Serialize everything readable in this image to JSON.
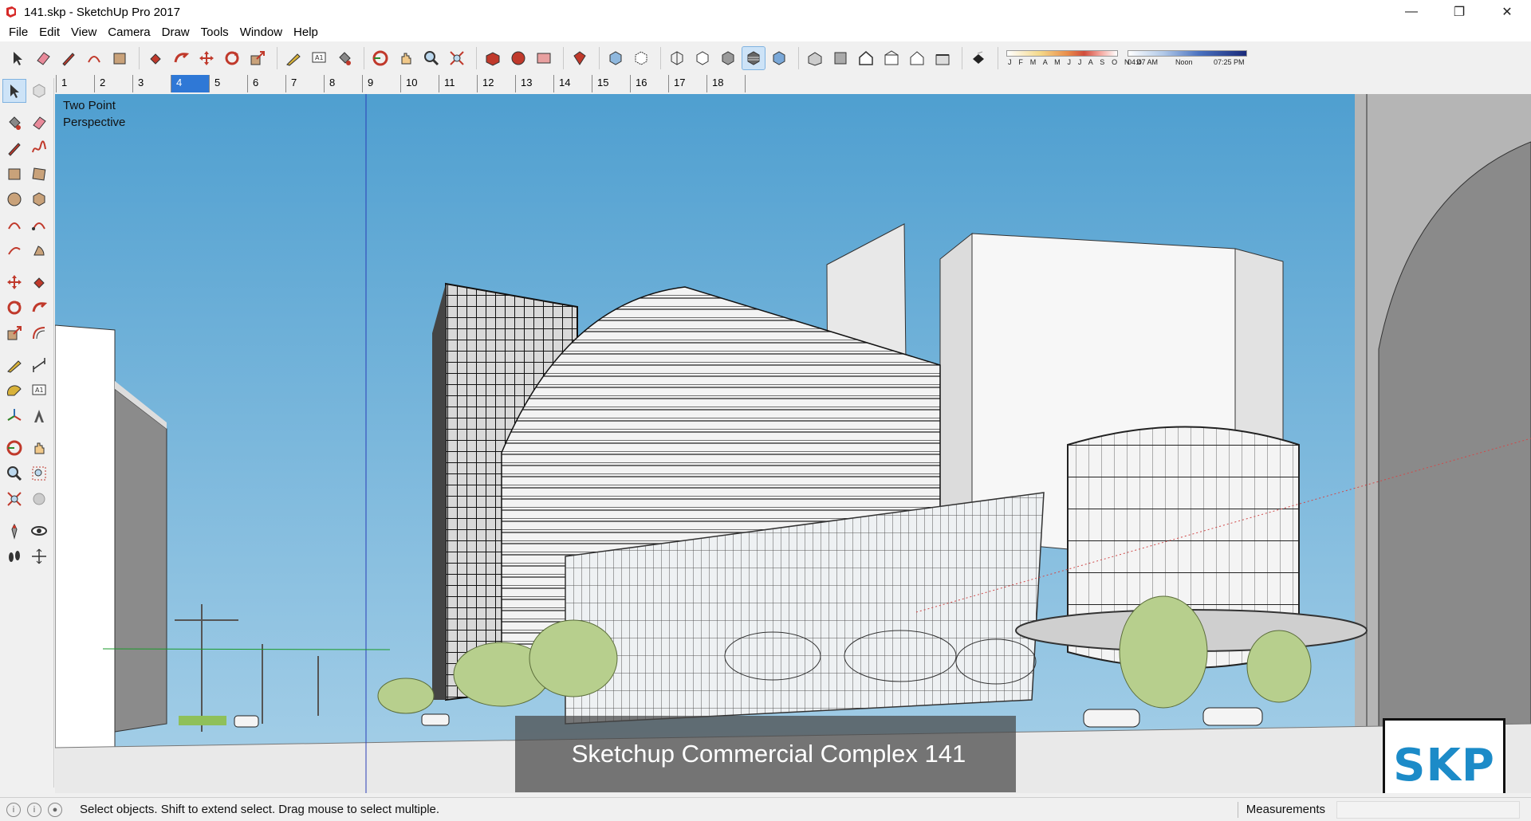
{
  "window": {
    "title": "141.skp - SketchUp Pro 2017",
    "minimize": "—",
    "restore": "❐",
    "close": "✕"
  },
  "menu": [
    "File",
    "Edit",
    "View",
    "Camera",
    "Draw",
    "Tools",
    "Window",
    "Help"
  ],
  "toolbar": {
    "groups": [
      [
        "select-icon",
        "eraser-icon",
        "pencil-icon",
        "arc-icon",
        "rectangle-icon"
      ],
      [
        "push-pull-icon",
        "follow-me-icon",
        "move-icon",
        "rotate-icon",
        "scale-icon"
      ],
      [
        "tape-measure-icon",
        "text-icon",
        "paint-bucket-icon"
      ],
      [
        "orbit-icon",
        "pan-icon",
        "zoom-icon",
        "zoom-extents-icon"
      ],
      [
        "3d-warehouse-icon",
        "extension-warehouse-icon",
        "layout-icon"
      ],
      [
        "extension-manager-icon"
      ],
      [
        "xray-icon",
        "back-edges-icon"
      ],
      [
        "wireframe-icon",
        "hidden-line-icon",
        "shaded-icon",
        "shaded-textures-icon",
        "monochrome-icon"
      ],
      [
        "iso-view-icon",
        "top-view-icon",
        "front-view-icon",
        "right-view-icon",
        "back-view-icon",
        "left-view-icon"
      ],
      [
        "shadows-toggle-icon"
      ]
    ],
    "active": "shaded-textures-icon",
    "shadow": {
      "months": "J F M A M J J A S O N D",
      "time_start": "04:47 AM",
      "time_mid": "Noon",
      "time_end": "07:25 PM"
    }
  },
  "scenes": [
    "1",
    "2",
    "3",
    "4",
    "5",
    "6",
    "7",
    "8",
    "9",
    "10",
    "11",
    "12",
    "13",
    "14",
    "15",
    "16",
    "17",
    "18"
  ],
  "active_scene": "4",
  "left_toolbar": [
    [
      "select-icon",
      "component-icon"
    ],
    [
      "paint-bucket-icon",
      "eraser-icon"
    ],
    [
      "line-icon",
      "freehand-icon"
    ],
    [
      "rectangle-icon",
      "rotated-rectangle-icon"
    ],
    [
      "circle-icon",
      "polygon-icon"
    ],
    [
      "arc-icon",
      "2pt-arc-icon"
    ],
    [
      "3pt-arc-icon",
      "pie-icon"
    ],
    [
      "move-icon",
      "push-pull-icon"
    ],
    [
      "rotate-icon",
      "follow-me-icon"
    ],
    [
      "scale-icon",
      "offset-icon"
    ],
    [
      "tape-measure-icon",
      "dimension-icon"
    ],
    [
      "protractor-icon",
      "text-icon"
    ],
    [
      "axes-icon",
      "3d-text-icon"
    ],
    [
      "orbit-icon",
      "pan-icon"
    ],
    [
      "zoom-icon",
      "zoom-window-icon"
    ],
    [
      "zoom-extents-icon",
      "previous-view-icon"
    ],
    [
      "position-camera-icon",
      "look-around-icon"
    ],
    [
      "walk-icon",
      "section-plane-icon"
    ]
  ],
  "viewport": {
    "camera_mode_line1": "Two Point",
    "camera_mode_line2": "Perspective",
    "caption": "Sketchup Commercial Complex 141",
    "logo": "SKP",
    "sky_color": "#5aa9d5"
  },
  "status": {
    "message": "Select objects. Shift to extend select. Drag mouse to select multiple.",
    "measurements_label": "Measurements",
    "measurements_value": ""
  }
}
